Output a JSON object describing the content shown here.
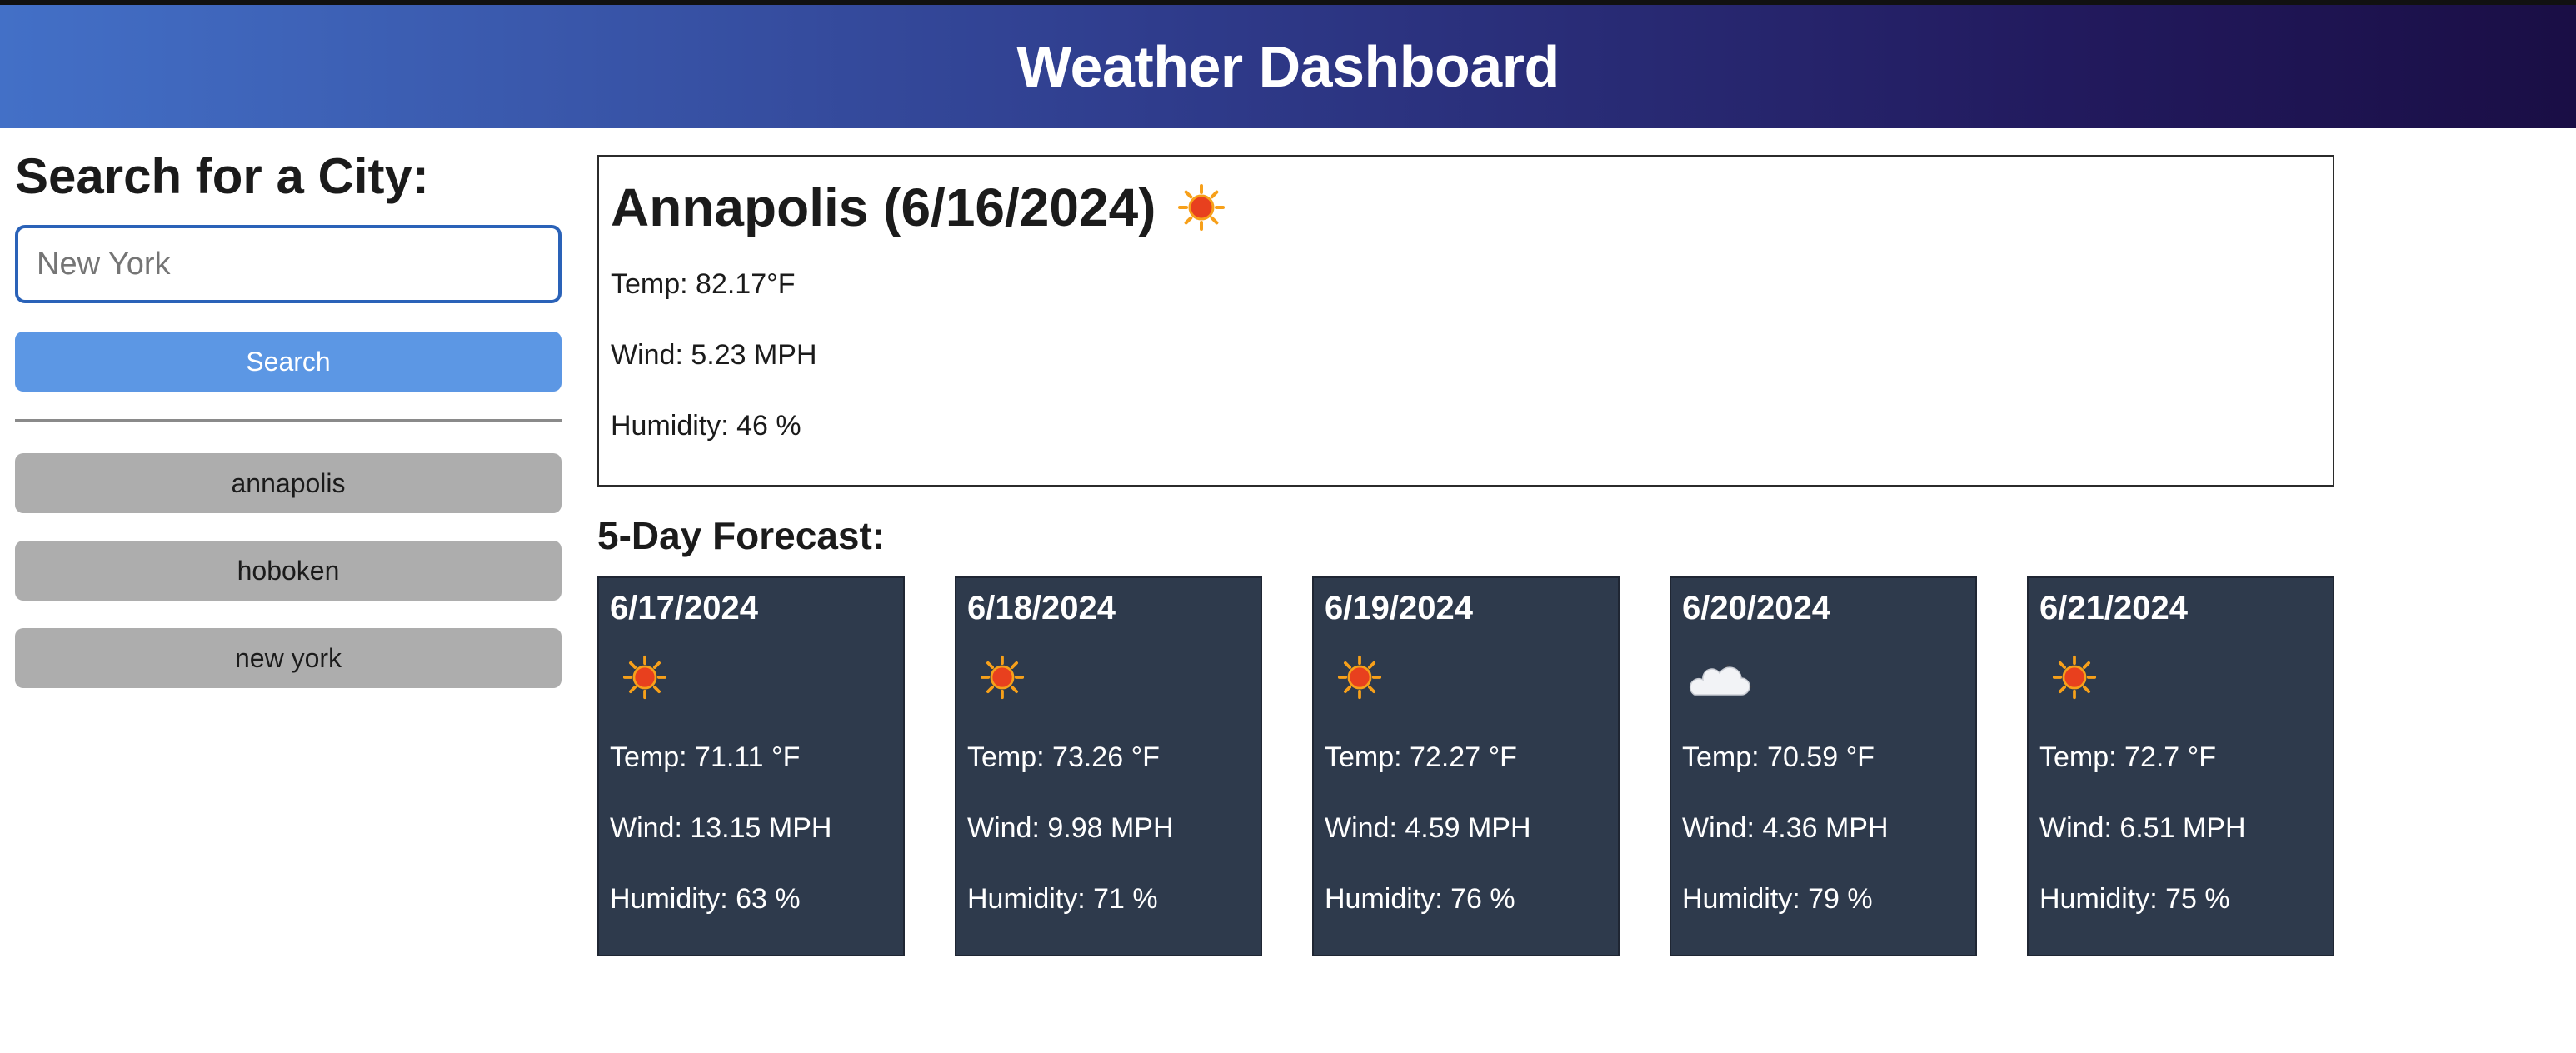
{
  "header": {
    "title": "Weather Dashboard"
  },
  "sidebar": {
    "heading": "Search for a City:",
    "search": {
      "placeholder": "New York",
      "value": ""
    },
    "search_button": "Search",
    "history": [
      {
        "label": "annapolis"
      },
      {
        "label": "hoboken"
      },
      {
        "label": "new york"
      }
    ]
  },
  "current": {
    "title": "Annapolis (6/16/2024)",
    "icon": "sun-icon",
    "temp": "Temp: 82.17°F",
    "wind": "Wind: 5.23 MPH",
    "humidity": "Humidity: 46 %"
  },
  "forecast": {
    "heading": "5-Day Forecast:",
    "days": [
      {
        "date": "6/17/2024",
        "icon": "sun-icon",
        "temp": "Temp: 71.11 °F",
        "wind": "Wind: 13.15 MPH",
        "humidity": "Humidity: 63 %"
      },
      {
        "date": "6/18/2024",
        "icon": "sun-icon",
        "temp": "Temp: 73.26 °F",
        "wind": "Wind: 9.98 MPH",
        "humidity": "Humidity: 71 %"
      },
      {
        "date": "6/19/2024",
        "icon": "sun-icon",
        "temp": "Temp: 72.27 °F",
        "wind": "Wind: 4.59 MPH",
        "humidity": "Humidity: 76 %"
      },
      {
        "date": "6/20/2024",
        "icon": "cloud-moon-icon",
        "temp": "Temp: 70.59 °F",
        "wind": "Wind: 4.36 MPH",
        "humidity": "Humidity: 79 %"
      },
      {
        "date": "6/21/2024",
        "icon": "sun-icon",
        "temp": "Temp: 72.7 °F",
        "wind": "Wind: 6.51 MPH",
        "humidity": "Humidity: 75 %"
      }
    ]
  },
  "colors": {
    "header_gradient_start": "#4370c7",
    "header_gradient_end": "#1a0e45",
    "search_button": "#5c97e4",
    "history_button": "#adadad",
    "forecast_card": "#2e3a4c"
  }
}
